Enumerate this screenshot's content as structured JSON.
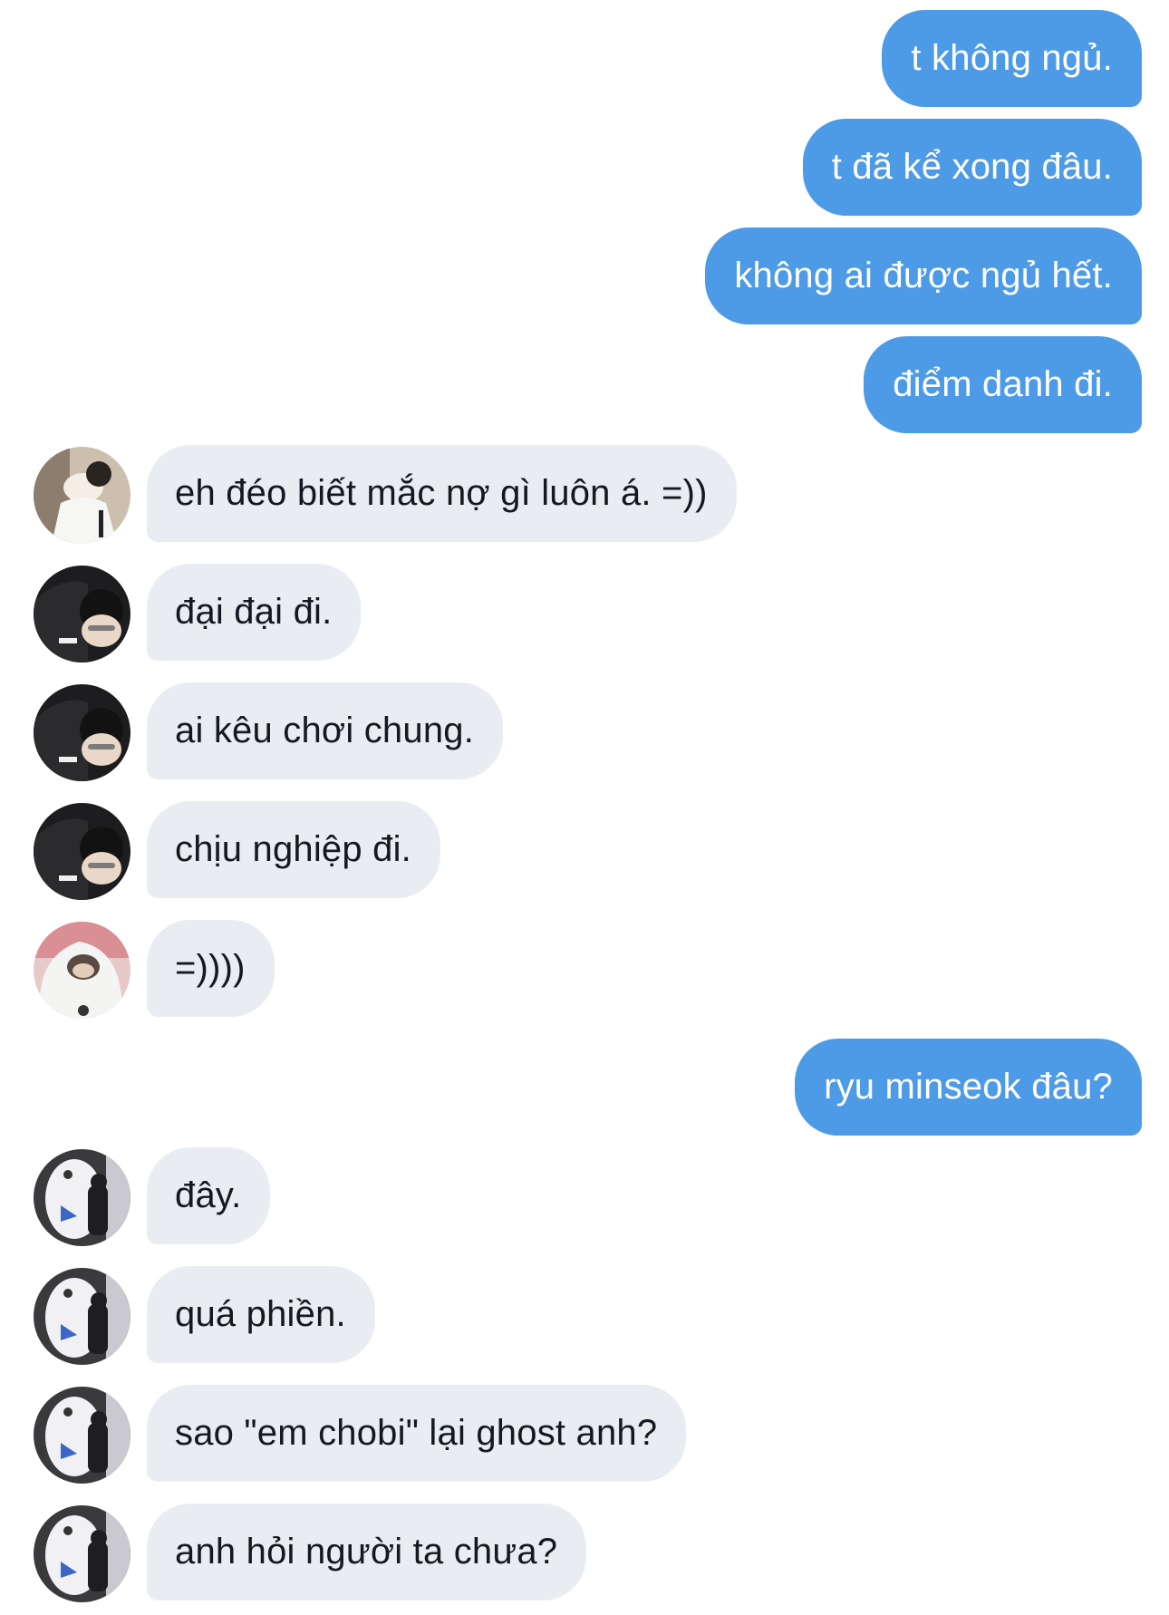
{
  "colors": {
    "outgoing_bubble": "#4d9be6",
    "incoming_bubble": "#e9edf1",
    "outgoing_text": "#ffffff",
    "incoming_text": "#141823"
  },
  "messages": [
    {
      "dir": "out",
      "text": "t không ngủ."
    },
    {
      "dir": "out",
      "text": "t đã kể xong đâu."
    },
    {
      "dir": "out",
      "text": "không ai được ngủ hết."
    },
    {
      "dir": "out",
      "text": "điểm danh đi."
    },
    {
      "dir": "in",
      "avatar": "avatar-dog-hug",
      "text": "eh đéo biết mắc nợ gì luôn á. =))"
    },
    {
      "dir": "in",
      "avatar": "avatar-black-jacket",
      "text": "đại đại đi."
    },
    {
      "dir": "in",
      "avatar": "avatar-black-jacket",
      "text": "ai kêu chơi chung."
    },
    {
      "dir": "in",
      "avatar": "avatar-black-jacket",
      "text": "chịu nghiệp đi."
    },
    {
      "dir": "in",
      "avatar": "avatar-white-hood",
      "text": "=))))"
    },
    {
      "dir": "out",
      "text": "ryu minseok đâu?"
    },
    {
      "dir": "in",
      "avatar": "avatar-mascot-hug",
      "text": "đây."
    },
    {
      "dir": "in",
      "avatar": "avatar-mascot-hug",
      "text": "quá phiền."
    },
    {
      "dir": "in",
      "avatar": "avatar-mascot-hug",
      "text": "sao \"em chobi\" lại ghost anh?"
    },
    {
      "dir": "in",
      "avatar": "avatar-mascot-hug",
      "text": "anh hỏi người ta chưa?"
    }
  ]
}
